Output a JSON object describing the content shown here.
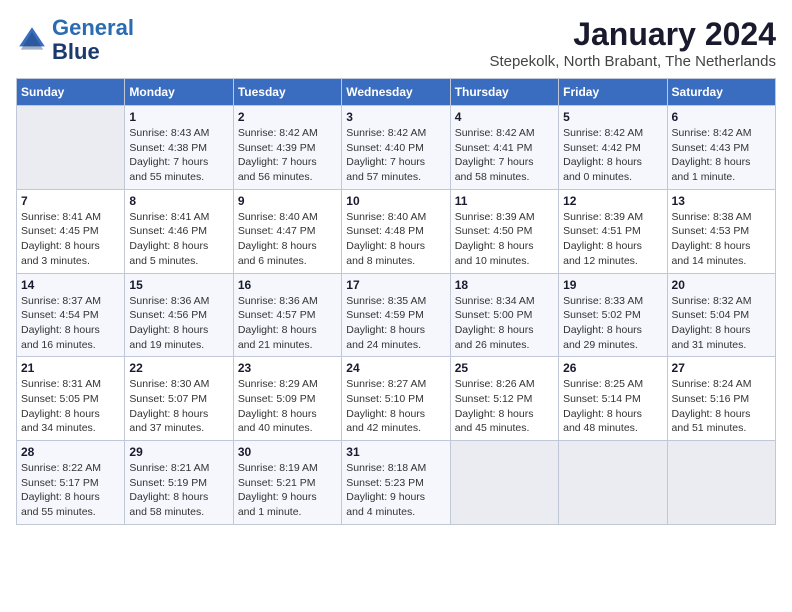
{
  "header": {
    "logo_line1": "General",
    "logo_line2": "Blue",
    "title": "January 2024",
    "subtitle": "Stepekolk, North Brabant, The Netherlands"
  },
  "calendar": {
    "days_of_week": [
      "Sunday",
      "Monday",
      "Tuesday",
      "Wednesday",
      "Thursday",
      "Friday",
      "Saturday"
    ],
    "weeks": [
      [
        {
          "day": "",
          "detail": ""
        },
        {
          "day": "1",
          "detail": "Sunrise: 8:43 AM\nSunset: 4:38 PM\nDaylight: 7 hours\nand 55 minutes."
        },
        {
          "day": "2",
          "detail": "Sunrise: 8:42 AM\nSunset: 4:39 PM\nDaylight: 7 hours\nand 56 minutes."
        },
        {
          "day": "3",
          "detail": "Sunrise: 8:42 AM\nSunset: 4:40 PM\nDaylight: 7 hours\nand 57 minutes."
        },
        {
          "day": "4",
          "detail": "Sunrise: 8:42 AM\nSunset: 4:41 PM\nDaylight: 7 hours\nand 58 minutes."
        },
        {
          "day": "5",
          "detail": "Sunrise: 8:42 AM\nSunset: 4:42 PM\nDaylight: 8 hours\nand 0 minutes."
        },
        {
          "day": "6",
          "detail": "Sunrise: 8:42 AM\nSunset: 4:43 PM\nDaylight: 8 hours\nand 1 minute."
        }
      ],
      [
        {
          "day": "7",
          "detail": "Sunrise: 8:41 AM\nSunset: 4:45 PM\nDaylight: 8 hours\nand 3 minutes."
        },
        {
          "day": "8",
          "detail": "Sunrise: 8:41 AM\nSunset: 4:46 PM\nDaylight: 8 hours\nand 5 minutes."
        },
        {
          "day": "9",
          "detail": "Sunrise: 8:40 AM\nSunset: 4:47 PM\nDaylight: 8 hours\nand 6 minutes."
        },
        {
          "day": "10",
          "detail": "Sunrise: 8:40 AM\nSunset: 4:48 PM\nDaylight: 8 hours\nand 8 minutes."
        },
        {
          "day": "11",
          "detail": "Sunrise: 8:39 AM\nSunset: 4:50 PM\nDaylight: 8 hours\nand 10 minutes."
        },
        {
          "day": "12",
          "detail": "Sunrise: 8:39 AM\nSunset: 4:51 PM\nDaylight: 8 hours\nand 12 minutes."
        },
        {
          "day": "13",
          "detail": "Sunrise: 8:38 AM\nSunset: 4:53 PM\nDaylight: 8 hours\nand 14 minutes."
        }
      ],
      [
        {
          "day": "14",
          "detail": "Sunrise: 8:37 AM\nSunset: 4:54 PM\nDaylight: 8 hours\nand 16 minutes."
        },
        {
          "day": "15",
          "detail": "Sunrise: 8:36 AM\nSunset: 4:56 PM\nDaylight: 8 hours\nand 19 minutes."
        },
        {
          "day": "16",
          "detail": "Sunrise: 8:36 AM\nSunset: 4:57 PM\nDaylight: 8 hours\nand 21 minutes."
        },
        {
          "day": "17",
          "detail": "Sunrise: 8:35 AM\nSunset: 4:59 PM\nDaylight: 8 hours\nand 24 minutes."
        },
        {
          "day": "18",
          "detail": "Sunrise: 8:34 AM\nSunset: 5:00 PM\nDaylight: 8 hours\nand 26 minutes."
        },
        {
          "day": "19",
          "detail": "Sunrise: 8:33 AM\nSunset: 5:02 PM\nDaylight: 8 hours\nand 29 minutes."
        },
        {
          "day": "20",
          "detail": "Sunrise: 8:32 AM\nSunset: 5:04 PM\nDaylight: 8 hours\nand 31 minutes."
        }
      ],
      [
        {
          "day": "21",
          "detail": "Sunrise: 8:31 AM\nSunset: 5:05 PM\nDaylight: 8 hours\nand 34 minutes."
        },
        {
          "day": "22",
          "detail": "Sunrise: 8:30 AM\nSunset: 5:07 PM\nDaylight: 8 hours\nand 37 minutes."
        },
        {
          "day": "23",
          "detail": "Sunrise: 8:29 AM\nSunset: 5:09 PM\nDaylight: 8 hours\nand 40 minutes."
        },
        {
          "day": "24",
          "detail": "Sunrise: 8:27 AM\nSunset: 5:10 PM\nDaylight: 8 hours\nand 42 minutes."
        },
        {
          "day": "25",
          "detail": "Sunrise: 8:26 AM\nSunset: 5:12 PM\nDaylight: 8 hours\nand 45 minutes."
        },
        {
          "day": "26",
          "detail": "Sunrise: 8:25 AM\nSunset: 5:14 PM\nDaylight: 8 hours\nand 48 minutes."
        },
        {
          "day": "27",
          "detail": "Sunrise: 8:24 AM\nSunset: 5:16 PM\nDaylight: 8 hours\nand 51 minutes."
        }
      ],
      [
        {
          "day": "28",
          "detail": "Sunrise: 8:22 AM\nSunset: 5:17 PM\nDaylight: 8 hours\nand 55 minutes."
        },
        {
          "day": "29",
          "detail": "Sunrise: 8:21 AM\nSunset: 5:19 PM\nDaylight: 8 hours\nand 58 minutes."
        },
        {
          "day": "30",
          "detail": "Sunrise: 8:19 AM\nSunset: 5:21 PM\nDaylight: 9 hours\nand 1 minute."
        },
        {
          "day": "31",
          "detail": "Sunrise: 8:18 AM\nSunset: 5:23 PM\nDaylight: 9 hours\nand 4 minutes."
        },
        {
          "day": "",
          "detail": ""
        },
        {
          "day": "",
          "detail": ""
        },
        {
          "day": "",
          "detail": ""
        }
      ]
    ]
  }
}
